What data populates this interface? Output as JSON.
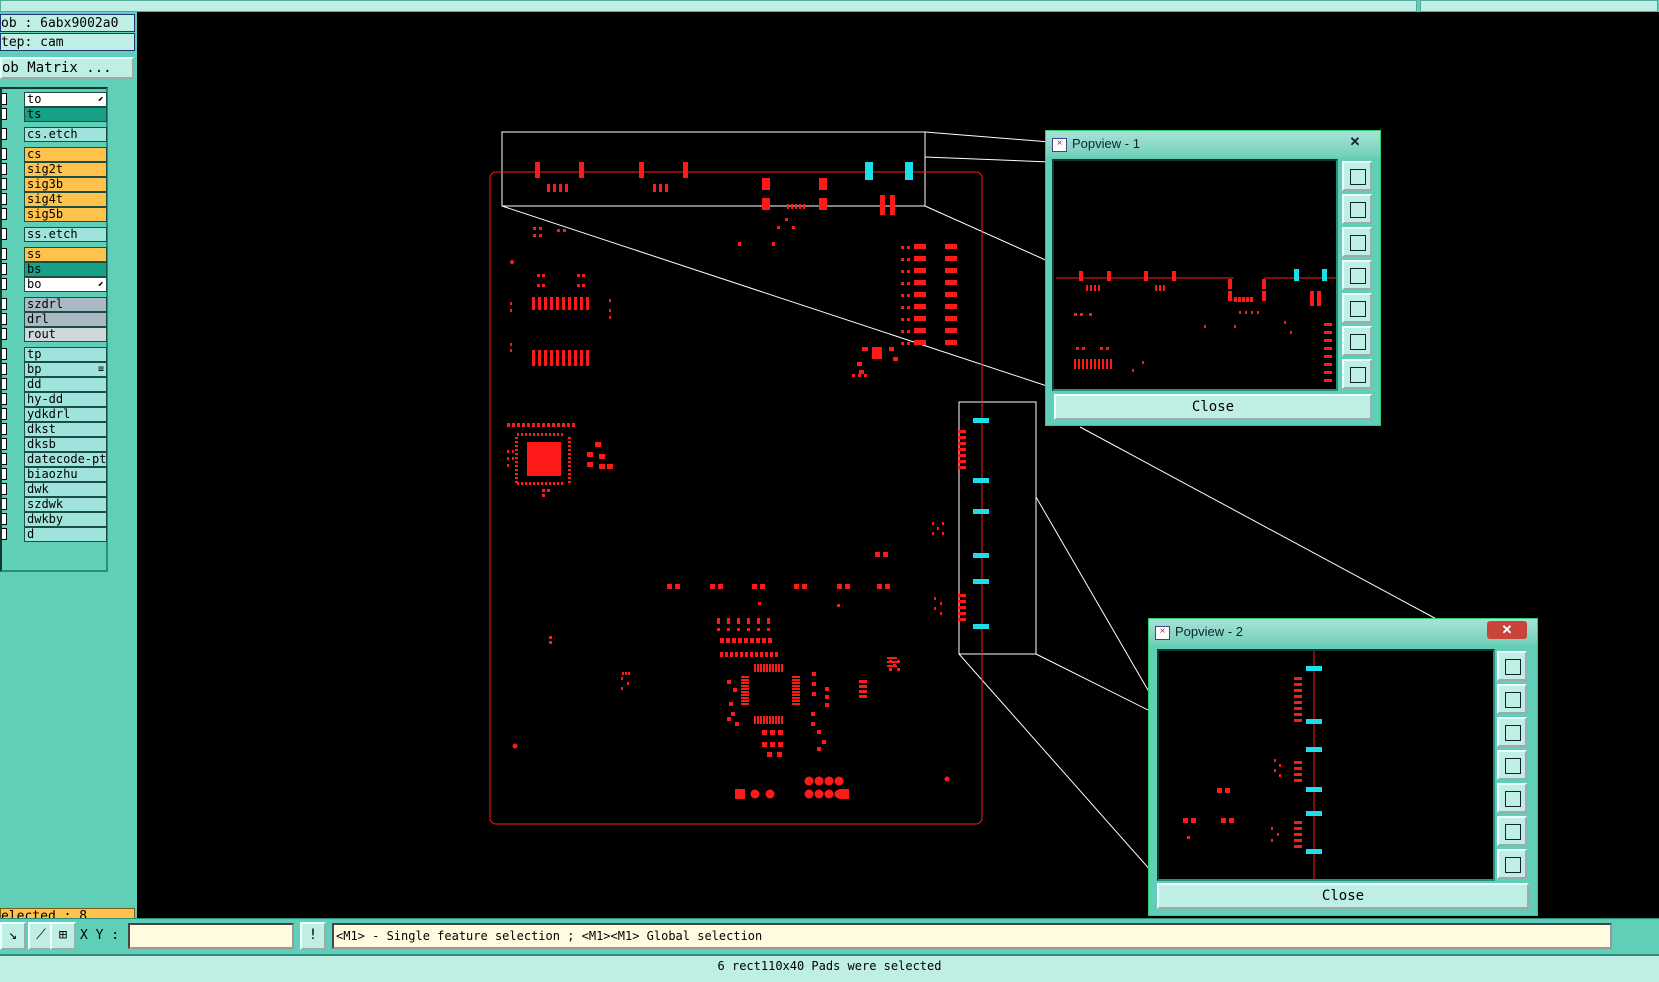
{
  "job_label": "ob : 6abx9002a0",
  "step_label": "tep: cam",
  "matrix_button": "ob Matrix ...",
  "layers": [
    {
      "name": "to",
      "color": "white",
      "mark": "⬋"
    },
    {
      "name": "ts",
      "color": "teal"
    },
    {
      "name": "cs.etch",
      "color": "cyan"
    },
    {
      "name": "cs",
      "color": "orange"
    },
    {
      "name": "sig2t",
      "color": "orange"
    },
    {
      "name": "sig3b",
      "color": "orange"
    },
    {
      "name": "sig4t",
      "color": "orange"
    },
    {
      "name": "sig5b",
      "color": "orange"
    },
    {
      "name": "ss.etch",
      "color": "cyan"
    },
    {
      "name": "ss",
      "color": "orange"
    },
    {
      "name": "bs",
      "color": "teal"
    },
    {
      "name": "bo",
      "color": "white",
      "mark": "⬋"
    },
    {
      "name": "szdrl",
      "color": "gray"
    },
    {
      "name": "drl",
      "color": "gray"
    },
    {
      "name": "rout",
      "color": "lgray"
    },
    {
      "name": "tp",
      "color": "cyan"
    },
    {
      "name": "bp",
      "color": "cyan",
      "mark": "≡"
    },
    {
      "name": "dd",
      "color": "cyan"
    },
    {
      "name": "hy-dd",
      "color": "cyan"
    },
    {
      "name": "ydkdrl",
      "color": "cyan"
    },
    {
      "name": "dkst",
      "color": "cyan"
    },
    {
      "name": "dksb",
      "color": "cyan"
    },
    {
      "name": "datecode-pth",
      "color": "cyan"
    },
    {
      "name": "biaozhu",
      "color": "cyan"
    },
    {
      "name": "dwk",
      "color": "cyan"
    },
    {
      "name": "szdwk",
      "color": "cyan"
    },
    {
      "name": "dwkby",
      "color": "cyan"
    },
    {
      "name": "d",
      "color": "cyan"
    }
  ],
  "selected_label": "elected : 8",
  "xy_label": "X Y :",
  "xy_value": "",
  "message": "<M1> - Single feature selection ; <M1><M1> Global selection",
  "status": "6 rect110x40 Pads were selected",
  "popview1": {
    "title": "Popview - 1",
    "close_label": "Close"
  },
  "popview2": {
    "title": "Popview - 2",
    "close_label": "Close"
  },
  "colors": {
    "feature": "#ff1a1a",
    "selected": "#19e0e8",
    "outline": "#ffffff",
    "background": "#000000"
  }
}
